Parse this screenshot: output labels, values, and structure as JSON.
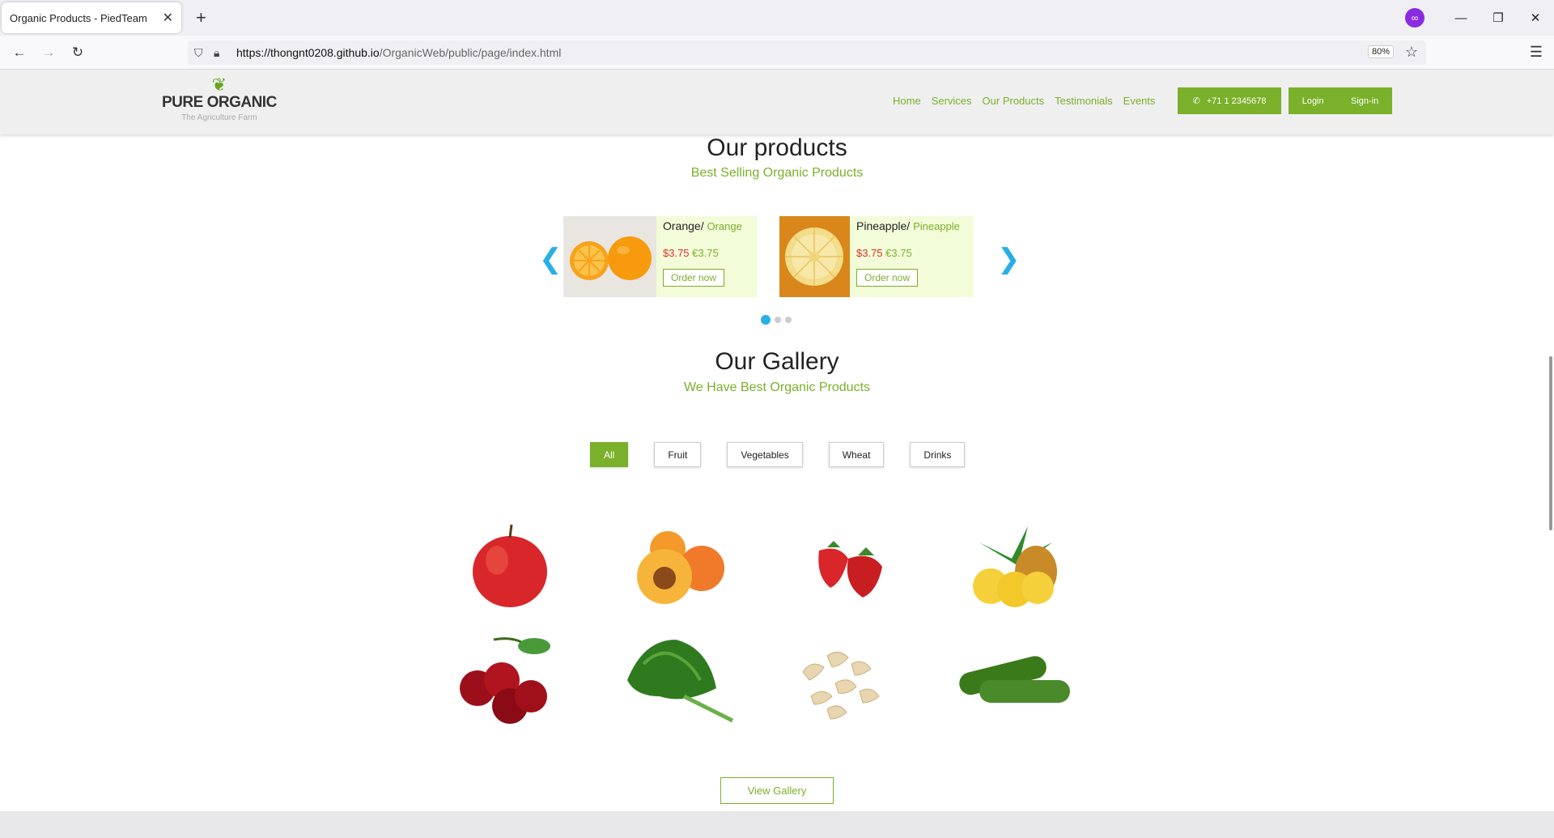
{
  "browser": {
    "tab_title": "Organic Products - PiedTeam",
    "tab_close": "✕",
    "new_tab": "+",
    "url_host": "https://thongnt0208.github.io",
    "url_path": "/OrganicWeb/public/page/index.html",
    "zoom": "80%"
  },
  "header": {
    "brand": "PURE ORGANIC",
    "tagline": "The Agriculture Farm",
    "nav": [
      "Home",
      "Services",
      "Our Products",
      "Testimonials",
      "Events"
    ],
    "phone": "+71 1 2345678",
    "login": "Login",
    "signin": "Sign-in"
  },
  "products": {
    "title": "Our products",
    "subtitle": "Best Selling Organic Products",
    "items": [
      {
        "name": "Orange/",
        "alt_name": "Orange",
        "price_usd": "$3.75",
        "price_eur": "€3.75",
        "order": "Order now"
      },
      {
        "name": "Pineapple/",
        "alt_name": "Pineapple",
        "price_usd": "$3.75",
        "price_eur": "€3.75",
        "order": "Order now"
      }
    ],
    "carousel_dots": 3,
    "active_dot": 0
  },
  "gallery": {
    "title": "Our Gallery",
    "subtitle": "We Have Best Organic Products",
    "filters": [
      "All",
      "Fruit",
      "Vegetables",
      "Wheat",
      "Drinks"
    ],
    "active_filter": "All",
    "items": [
      "apple",
      "apricots",
      "strawberries",
      "pineapple",
      "cherries",
      "kale",
      "cashews",
      "cucumbers"
    ],
    "view_button": "View Gallery"
  },
  "colors": {
    "accent": "#7ab02a",
    "price": "#e0302a",
    "carousel": "#29aee6"
  }
}
